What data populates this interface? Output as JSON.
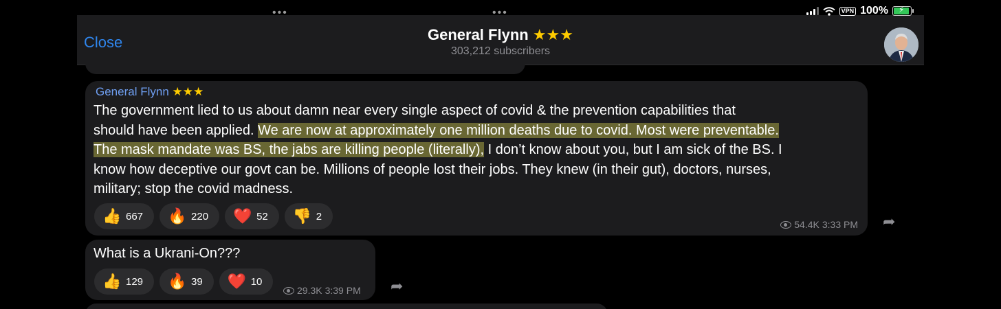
{
  "status_bar": {
    "battery_text": "100%",
    "vpn_label": "VPN",
    "dots": "•••",
    "battery_level": 1.0
  },
  "header": {
    "close_label": "Close",
    "title": "General Flynn",
    "stars": "★★★",
    "subscribers": "303,212 subscribers"
  },
  "messages": [
    {
      "sender": "General Flynn",
      "sender_stars": "★★★",
      "line1": "The government lied to us about damn near every single aspect of covid & the prevention capabilities that",
      "line2_plain": "should have been applied. ",
      "line2_hl": "We are now at approximately one million deaths due to covid. Most were preventable.",
      "line3_hl": "The mask mandate was BS, the jabs are killing people (literally),",
      "line3_plain": " I don’t know about you, but I am sick of the BS. I",
      "line4": "know how deceptive our govt can be. Millions of people lost their jobs. They knew (in their gut), doctors, nurses,",
      "line5": "military; stop the covid madness.",
      "reactions": [
        {
          "emoji": "👍",
          "count": "667"
        },
        {
          "emoji": "🔥",
          "count": "220"
        },
        {
          "emoji": "❤️",
          "count": "52"
        },
        {
          "emoji": "👎",
          "count": "2"
        }
      ],
      "views": "54.4K",
      "time": "3:33 PM"
    },
    {
      "text": "What is a Ukrani-On???",
      "reactions": [
        {
          "emoji": "👍",
          "count": "129"
        },
        {
          "emoji": "🔥",
          "count": "39"
        },
        {
          "emoji": "❤️",
          "count": "10"
        }
      ],
      "views": "29.3K",
      "time": "3:39 PM"
    }
  ],
  "colors": {
    "accent": "#2f86ee",
    "sender": "#6f9ff2",
    "highlight": "#a9a546",
    "bubble": "#1c1c1e"
  }
}
